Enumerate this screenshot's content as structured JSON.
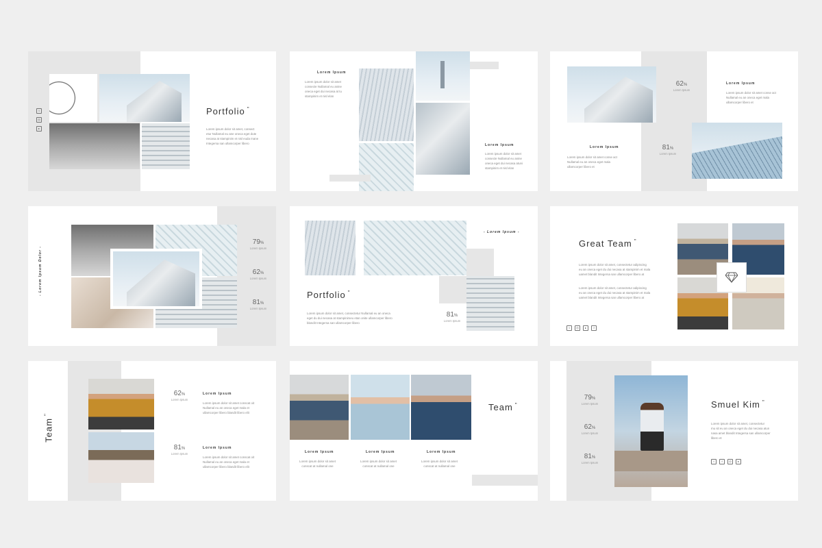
{
  "slides": {
    "s1": {
      "title": "Portfolio",
      "text": [
        "Lorem ipsum dolor sit amet, consect",
        "etur Nullamal eu ane oneca eget dute",
        "necasa at stampinim et nisl euda mane",
        "Integersa san ullamcorper libero"
      ],
      "icons": [
        "twitter-icon",
        "instagram-icon",
        "youtube-icon"
      ]
    },
    "s2": {
      "block1": {
        "label": "Lorem Ipsum",
        "text": [
          "Lorem ipsum dolor sit amet",
          "consecte Nullamal eu anine",
          "oneca eget dui necasa at tu",
          "stampinim et nisl elan"
        ]
      },
      "block2": {
        "label": "Lorem Ipsum",
        "text": [
          "Lorem ipsum dolor sit amet",
          "consecte Nullamal eu anine",
          "oneca eget dui necasa atuni",
          "stampinim et nisl elan"
        ]
      }
    },
    "s3": {
      "stat1": {
        "num": "62",
        "pct": "%",
        "sub": "Lorem Ipsum"
      },
      "stat2": {
        "num": "81",
        "pct": "%",
        "sub": "Lorem Ipsum"
      },
      "block1": {
        "label": "Lorem Ipsum",
        "text": [
          "Lorem ipsum dolor sit amet conse act",
          "Nullamal eu an oneca eget mala",
          "ullamcorper libero et"
        ]
      },
      "block2": {
        "label": "Lorem Ipsum",
        "text": [
          "Lorem ipsum dolor sit amet conse act",
          "Nullamal eu an oneca eget mala",
          "ullamcorper libero et"
        ]
      }
    },
    "s4": {
      "vertical": "- Lorem Ipsum Dolor -",
      "stats": [
        {
          "num": "79",
          "pct": "%",
          "sub": "Lorem Ipsum"
        },
        {
          "num": "62",
          "pct": "%",
          "sub": "Lorem Ipsum"
        },
        {
          "num": "81",
          "pct": "%",
          "sub": "Lorem Ipsum"
        }
      ]
    },
    "s5": {
      "title": "Portfolio",
      "tag": "- Lorem Ipsum -",
      "text": [
        "Lorem ipsum dolor sit amet, consectetur Nullamal eu an oneca",
        "eget du dui necasa at stampinimeu etan onite ullamcorper libero",
        "blandit Integersa san ullamcorper libero"
      ],
      "stat": {
        "num": "81",
        "pct": "%",
        "sub": "Lorem Ipsum"
      }
    },
    "s6": {
      "title": "Great Team",
      "text1": [
        "Lorem ipsum dolor sit amet, consectetur adipiscing",
        "eu an oneca eget du dui necasa at stampinim et mala",
        "uamet blandit Integersa san ullamcorper libero at"
      ],
      "text2": [
        "Lorem ipsum dolor sit amet, consectetur adipiscing",
        "eu an oneca eget du dui necasa at stampinim et mala",
        "uamet blandit Integersa san ullamcorper libero at"
      ],
      "icons": [
        "twitter-icon",
        "instagram-icon",
        "youtube-icon",
        "facebook-icon"
      ]
    },
    "s7": {
      "title": "Team",
      "stat1": {
        "num": "62",
        "pct": "%",
        "sub": "Lorem Ipsum"
      },
      "stat2": {
        "num": "81",
        "pct": "%",
        "sub": "Lorem Ipsum"
      },
      "block1": {
        "label": "Lorem Ipsum",
        "text": [
          "Lorem ipsum dolor sit amet conscat oit",
          "Nullamal eu an oneca eget mala et",
          "ullamcorper libero blandit libero elit"
        ]
      },
      "block2": {
        "label": "Lorem Ipsum",
        "text": [
          "Lorem ipsum dolor sit amet conscat oit",
          "Nullamal eu an oneca eget mala et",
          "ullamcorper libero blandit libero elit"
        ]
      }
    },
    "s8": {
      "title": "Team",
      "members": [
        {
          "label": "Lorem Ipsum",
          "text": [
            "Lorem ipsum dolor sit amet",
            "conscat at nullamal one"
          ]
        },
        {
          "label": "Lorem Ipsum",
          "text": [
            "Lorem ipsum dolor sit amet",
            "conscat at nullamal one"
          ]
        },
        {
          "label": "Lorem Ipsum",
          "text": [
            "Lorem ipsum dolor sit amet",
            "conscat at nullamal one"
          ]
        }
      ]
    },
    "s9": {
      "title": "Smuel Kim",
      "stats": [
        {
          "num": "79",
          "pct": "%",
          "sub": "Lorem Ipsum"
        },
        {
          "num": "62",
          "pct": "%",
          "sub": "Lorem Ipsum"
        },
        {
          "num": "81",
          "pct": "%",
          "sub": "Lorem Ipsum"
        }
      ],
      "text": [
        "Lorem ipsum dolor sit amet, consectetur",
        "mu sit eu an oneca eget du dui necasa atun",
        "nasa amet blandit Integersa san ullamcorper",
        "libero et"
      ],
      "icons": [
        "twitter-icon",
        "facebook-icon",
        "instagram-icon",
        "youtube-icon"
      ]
    }
  }
}
